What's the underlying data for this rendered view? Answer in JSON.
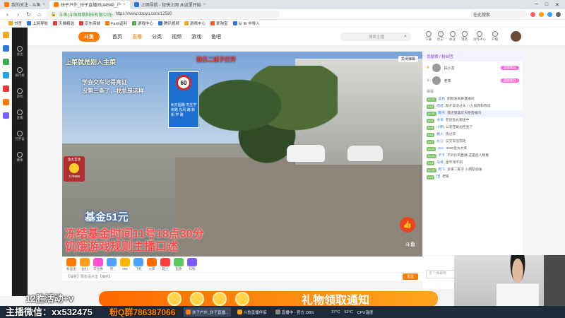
{
  "browser": {
    "tabs": [
      {
        "label": "我的关注 - 斗鱼",
        "active": false
      },
      {
        "label": "扶子户外_扶子直播间(44548_户",
        "active": true
      },
      {
        "label": "上网导航 - 轻快上网 从这里开始",
        "active": false
      }
    ],
    "url_site": "斗鱼(斗鱼网络科技有限公司)",
    "url_path": "https://www.douyu.com/12580",
    "search_placeholder": "在此搜索",
    "window_controls": [
      "─",
      "□",
      "✕"
    ]
  },
  "bookmarks": [
    {
      "label": "书签",
      "color": "#f5a623"
    },
    {
      "label": "上网导航",
      "color": "#2e79d6"
    },
    {
      "label": "天猫精选",
      "color": "#e53935"
    },
    {
      "label": "京东商城",
      "color": "#e53935"
    },
    {
      "label": "Fanli返利",
      "color": "#ff7a00"
    },
    {
      "label": "游戏中心",
      "color": "#4caf50"
    },
    {
      "label": "腾讯视频",
      "color": "#2e79d6"
    },
    {
      "label": "游戏中心",
      "color": "#f5a623"
    },
    {
      "label": "爱淘宝",
      "color": "#ff5722"
    },
    {
      "label": "从 IE 中导入",
      "color": "#2e79d6"
    }
  ],
  "site": {
    "logo": "斗鱼",
    "nav": [
      {
        "label": "首页",
        "active": false
      },
      {
        "label": "直播",
        "active": true
      },
      {
        "label": "分类",
        "active": false
      },
      {
        "label": "视频",
        "active": false
      },
      {
        "label": "游戏",
        "active": false
      },
      {
        "label": "鱼吧",
        "active": false
      }
    ],
    "search_placeholder": "搜索主播",
    "top_icons": [
      "下载",
      "历史",
      "关注",
      "消息",
      "创作中心",
      "开播"
    ],
    "left_menu": [
      "关注",
      "排行榜",
      "游戏",
      "直播",
      "元宇宙",
      "赛事"
    ]
  },
  "video": {
    "overlay_top_left": "上菜就是刚人主菜",
    "overlay_top_mid": "我已二班子打开",
    "overlay_line1": "学会交车记得亮证",
    "overlay_line2": "没第三条了，我总是这样",
    "sign_limit": "60",
    "sign_text": "树方圆路 刘庄学校路 东风 路 新 街 学 路",
    "fan_label": "鱼丸互动",
    "fan_count": "11/9999",
    "close_danmu": "关闭弹幕",
    "fund": "基金51元",
    "freeze": "冻结基金时间11号18点30分",
    "rules": "饥饿游戏规则主播口述",
    "watermark": "斗鱼"
  },
  "gifts": [
    {
      "label": "粉丝团",
      "color": "#ff7a00"
    },
    {
      "label": "鱼丸",
      "color": "#ff9f1a"
    },
    {
      "label": "荧光棒",
      "color": "#ff4dd2"
    },
    {
      "label": "赞",
      "color": "#4aa3ff"
    },
    {
      "label": "666",
      "color": "#ffb400"
    },
    {
      "label": "飞机",
      "color": "#4aa3ff"
    },
    {
      "label": "火箭",
      "color": "#ff6a00"
    },
    {
      "label": "超火",
      "color": "#ff3d3d"
    },
    {
      "label": "鱼翅",
      "color": "#5ac85a"
    },
    {
      "label": "礼物",
      "color": "#7a5cff"
    }
  ],
  "chat_input_placeholder": "【抽奖】赞粉请点击【抽奖】",
  "send_label": "发送",
  "chat": {
    "head": "贡献榜 / 粉丝团",
    "rank": [
      {
        "name": "扶小龙",
        "tag": "超级粉丝"
      },
      {
        "name": "老铁",
        "tag": "超级粉丝"
      }
    ],
    "section": "弹幕",
    "messages": [
      {
        "lv": "Lv.12",
        "name": "蓝色",
        "text": "刚刚发来单直播间"
      },
      {
        "lv": "Lv.8",
        "name": "哈哈",
        "text": "刚才说话过头 八九加我和我说"
      },
      {
        "lv": "Lv.15",
        "name": "陈天",
        "text": "我还是喜欢天使直播间"
      },
      {
        "lv": "Lv.6",
        "name": "龙哥",
        "text": "老鼠鱼丸赠送中"
      },
      {
        "lv": "Lv.9",
        "name": "小明",
        "text": "公安在路边检查了"
      },
      {
        "lv": "Lv.5",
        "name": "路人",
        "text": "绕过去"
      },
      {
        "lv": "Lv.7",
        "name": "长江",
        "text": "公交车往前走"
      },
      {
        "lv": "Lv.11",
        "name": "Zen",
        "text": "3000鱼丸大奖"
      },
      {
        "lv": "Lv.10",
        "name": "卡卡",
        "text": "不开价的直播 这是后人尊重"
      },
      {
        "lv": "Lv.4",
        "name": "马哥",
        "text": "金币领不到"
      },
      {
        "lv": "Lv.13",
        "name": "阿飞",
        "text": "没事二家子 小朋友加油"
      },
      {
        "lv": "Lv.3",
        "name": "团",
        "text": "老铁"
      }
    ],
    "input_placeholder": "发个弹幕吧"
  },
  "stream_banners": {
    "activity": "12胜活动+v",
    "wechat": "主播微信：xx532475",
    "qq": "粉Q群786387066",
    "gift_text": "礼物领取通知"
  },
  "taskbar": [
    {
      "label": "扶子户外_扶子直播...",
      "active": true
    },
    {
      "label": "斗鱼直播伴侣",
      "active": false
    },
    {
      "label": "直播中 - 官方 OBS",
      "active": false
    }
  ],
  "tray": {
    "temp": "37°C",
    "cpu": "52°C",
    "cpu_label": "CPU温度"
  },
  "colors": {
    "accent": "#ff7a00",
    "chat_level": "#7ec36a",
    "taskbar": "#1f2a3a"
  }
}
